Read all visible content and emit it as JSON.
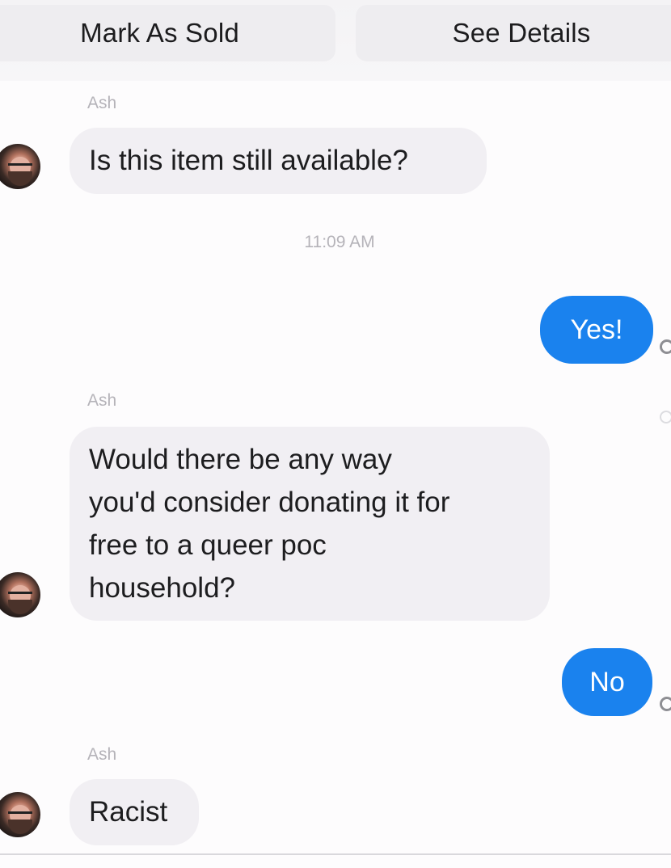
{
  "actions": {
    "mark_sold": "Mark As Sold",
    "see_details": "See Details"
  },
  "conversation": {
    "sender_name": "Ash",
    "timestamp": "11:09 AM",
    "messages": [
      {
        "from": "Ash",
        "text": "Is this item still available?"
      },
      {
        "from": "me",
        "text": "Yes!"
      },
      {
        "from": "Ash",
        "lines": [
          "Would there be any way",
          "you'd consider donating it for",
          "free to a queer poc",
          "household?"
        ]
      },
      {
        "from": "me",
        "text": "No"
      },
      {
        "from": "Ash",
        "text": "Racist"
      }
    ]
  },
  "colors": {
    "outgoing_bubble": "#1a82ee",
    "incoming_bubble": "#f1eff3",
    "meta_text": "#b5b3b9"
  },
  "icons": {
    "avatar": "profile-photo",
    "read_receipt": "read-receipt-icon"
  }
}
